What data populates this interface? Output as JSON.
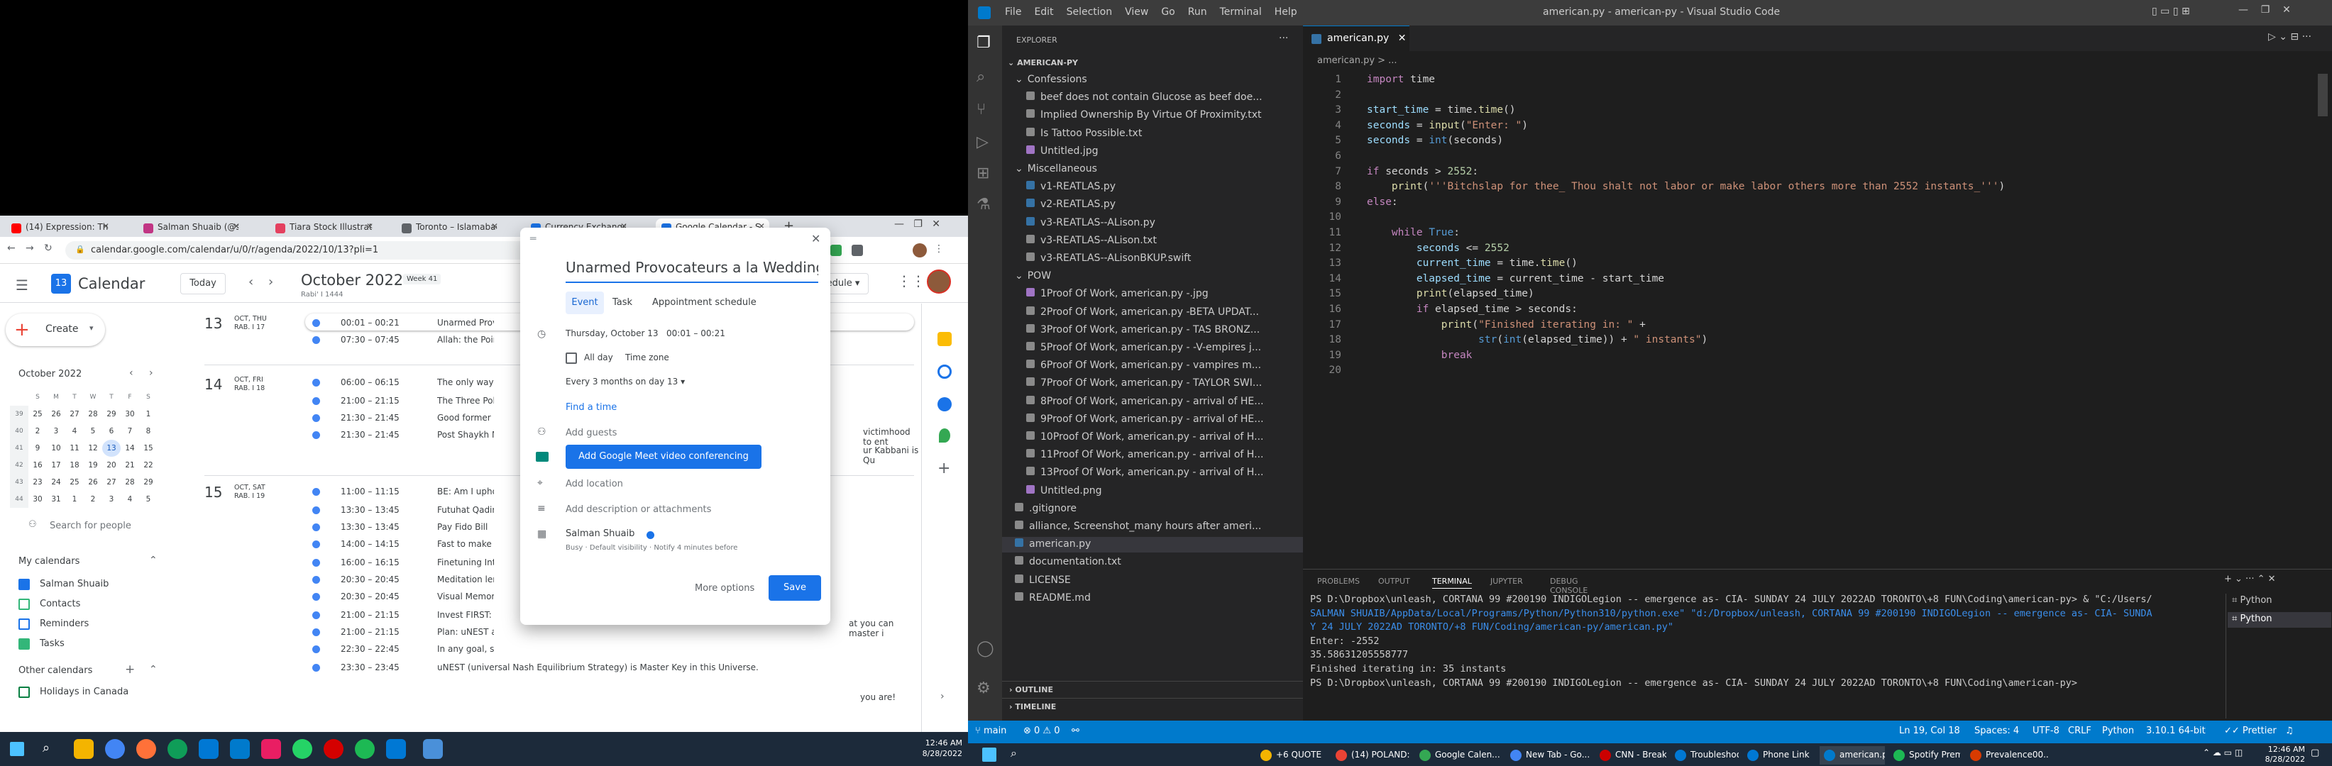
{
  "browser": {
    "tabs": [
      {
        "label": "(14) Expression: The ...",
        "color": "#ff0000"
      },
      {
        "label": "Salman Shuaib (@sa...",
        "color": "#c13584"
      },
      {
        "label": "Tiara Stock Illustratio...",
        "color": "#e4405f"
      },
      {
        "label": "Toronto – Islamabad ...",
        "color": "#5f6368"
      },
      {
        "label": "Currency Exchange R...",
        "color": "#1a73e8"
      },
      {
        "label": "Google Calendar - S...",
        "color": "#1a73e8"
      }
    ],
    "url": "calendar.google.com/calendar/u/0/r/agenda/2022/10/13?pli=1"
  },
  "calendar": {
    "app_title": "Calendar",
    "today_label": "Today",
    "month_title": "October 2022",
    "week_label": "Week 41",
    "rabi_label": "Rabi' I 1444",
    "view_label": "Schedule",
    "create_label": "Create",
    "mini_month": "October 2022",
    "mini_headers": [
      "",
      "S",
      "M",
      "T",
      "W",
      "T",
      "F",
      "S"
    ],
    "mini_rows": [
      [
        "39",
        "25",
        "26",
        "27",
        "28",
        "29",
        "30",
        "1"
      ],
      [
        "40",
        "2",
        "3",
        "4",
        "5",
        "6",
        "7",
        "8"
      ],
      [
        "41",
        "9",
        "10",
        "11",
        "12",
        "13",
        "14",
        "15"
      ],
      [
        "42",
        "16",
        "17",
        "18",
        "19",
        "20",
        "21",
        "22"
      ],
      [
        "43",
        "23",
        "24",
        "25",
        "26",
        "27",
        "28",
        "29"
      ],
      [
        "44",
        "30",
        "31",
        "1",
        "2",
        "3",
        "4",
        "5"
      ]
    ],
    "search_people": "Search for people",
    "my_calendars_title": "My calendars",
    "my_calendars": [
      {
        "label": "Salman Shuaib",
        "color": "#1a73e8",
        "checked": true
      },
      {
        "label": "Contacts",
        "color": "#33b679",
        "checked": false
      },
      {
        "label": "Reminders",
        "color": "#1a73e8",
        "checked": false
      },
      {
        "label": "Tasks",
        "color": "#33b679",
        "checked": true
      }
    ],
    "other_calendars_title": "Other calendars",
    "other_calendars": [
      {
        "label": "Holidays in Canada",
        "color": "#0b8043"
      }
    ],
    "days": [
      {
        "num": "13",
        "dow": "OCT, THU",
        "hijri": "RAB. I 17"
      },
      {
        "num": "14",
        "dow": "OCT, FRI",
        "hijri": "RAB. I 18"
      },
      {
        "num": "15",
        "dow": "OCT, SAT",
        "hijri": "RAB. I 19"
      }
    ],
    "events": [
      {
        "time": "00:01 – 00:21",
        "title": "Unarmed Provo..."
      },
      {
        "time": "07:30 – 07:45",
        "title": "Allah: the Point o..."
      },
      {
        "time": "06:00 – 06:15",
        "title": "The only way an..."
      },
      {
        "time": "21:00 – 21:15",
        "title": "The Three Polici..."
      },
      {
        "time": "21:30 – 21:45",
        "title": "Good former Bra..."
      },
      {
        "time": "21:30 – 21:45",
        "title": "Post Shaykh Me..."
      },
      {
        "time": "11:00 – 11:15",
        "title": "BE: Am I upholdi..."
      },
      {
        "time": "13:30 – 13:45",
        "title": "Futuhat Qadiriyy..."
      },
      {
        "time": "13:30 – 13:45",
        "title": "Pay Fido Bill"
      },
      {
        "time": "14:00 – 14:15",
        "title": "Fast to make sto..."
      },
      {
        "time": "16:00 – 16:15",
        "title": "Finetuning Integ..."
      },
      {
        "time": "20:30 – 20:45",
        "title": "Meditation lends..."
      },
      {
        "time": "20:30 – 20:45",
        "title": "Visual Memory N..."
      },
      {
        "time": "21:00 – 21:15",
        "title": "Invest FIRST: be..."
      },
      {
        "time": "21:00 – 21:15",
        "title": "Plan: uNEST appl..."
      },
      {
        "time": "22:30 – 22:45",
        "title": "In any goal, surro..."
      },
      {
        "time": "23:30 – 23:45",
        "title": "uNEST (universal Nash Equilibrium Strategy) is Master Key in this Universe."
      }
    ],
    "overflow_texts": [
      "victimhood to ent",
      "ur Kabbani is Qu",
      "at you can master i",
      "you are!"
    ]
  },
  "dialog": {
    "title": "Unarmed Provocateurs a la Wedding",
    "tabs": [
      "Event",
      "Task",
      "Appointment schedule"
    ],
    "date": "Thursday, October 13",
    "start": "00:01",
    "dash": "–",
    "end": "00:21",
    "all_day": "All day",
    "time_zone": "Time zone",
    "recurrence": "Every 3 months on day 13",
    "find_time": "Find a time",
    "add_guests": "Add guests",
    "meet_button": "Add Google Meet video conferencing",
    "add_location": "Add location",
    "add_description": "Add description or attachments",
    "owner": "Salman Shuaib",
    "owner_details": "Busy · Default visibility · Notify 4 minutes before",
    "more_options": "More options",
    "save": "Save"
  },
  "vscode": {
    "menu": [
      "File",
      "Edit",
      "Selection",
      "View",
      "Go",
      "Run",
      "Terminal",
      "Help"
    ],
    "window_title": "american.py - american-py - Visual Studio Code",
    "explorer_title": "EXPLORER",
    "root": "AMERICAN-PY",
    "tree": [
      {
        "label": "Confessions",
        "type": "folder"
      },
      {
        "label": "beef does not contain Glucose as beef doe...",
        "type": "file"
      },
      {
        "label": "Implied Ownership By Virtue Of Proximity.txt",
        "type": "file"
      },
      {
        "label": "Is Tattoo Possible.txt",
        "type": "file"
      },
      {
        "label": "Untitled.jpg",
        "type": "file"
      },
      {
        "label": "Miscellaneous",
        "type": "folder"
      },
      {
        "label": "v1-REATLAS.py",
        "type": "py"
      },
      {
        "label": "v2-REATLAS.py",
        "type": "py"
      },
      {
        "label": "v3-REATLAS--ALison.py",
        "type": "py"
      },
      {
        "label": "v3-REATLAS--ALison.txt",
        "type": "file"
      },
      {
        "label": "v3-REATLAS--ALisonBKUP.swift",
        "type": "file"
      },
      {
        "label": "POW",
        "type": "folder"
      },
      {
        "label": "1Proof Of Work, american.py -.jpg",
        "type": "file"
      },
      {
        "label": "2Proof Of Work, american.py -BETA UPDAT...",
        "type": "file"
      },
      {
        "label": "3Proof Of Work, american.py - TAS BRONZ...",
        "type": "file"
      },
      {
        "label": "5Proof Of Work, american.py - -V-empires j...",
        "type": "file"
      },
      {
        "label": "6Proof Of Work, american.py - vampires m...",
        "type": "file"
      },
      {
        "label": "7Proof Of Work, american.py - TAYLOR SWI...",
        "type": "file"
      },
      {
        "label": "8Proof Of Work, american.py - arrival of HE...",
        "type": "file"
      },
      {
        "label": "9Proof Of Work, american.py - arrival of HE...",
        "type": "file"
      },
      {
        "label": "10Proof Of Work, american.py - arrival of H...",
        "type": "file"
      },
      {
        "label": "11Proof Of Work, american.py - arrival of H...",
        "type": "file"
      },
      {
        "label": "13Proof Of Work, american.py - arrival of H...",
        "type": "file"
      },
      {
        "label": "Untitled.png",
        "type": "file"
      },
      {
        "label": ".gitignore",
        "type": "root"
      },
      {
        "label": "alliance, Screenshot_many hours after ameri...",
        "type": "root"
      },
      {
        "label": "american.py",
        "type": "root"
      },
      {
        "label": "documentation.txt",
        "type": "root"
      },
      {
        "label": "LICENSE",
        "type": "root"
      },
      {
        "label": "README.md",
        "type": "root"
      }
    ],
    "outline": "OUTLINE",
    "timeline": "TIMELINE",
    "editor_tab": "american.py",
    "breadcrumb": "american.py > ...",
    "panel_tabs": [
      "PROBLEMS",
      "OUTPUT",
      "TERMINAL",
      "JUPYTER",
      "DEBUG CONSOLE"
    ],
    "terminal_lines": [
      "PS D:\\Dropbox\\unleash, CORTANA 99 #200190 INDIGOLegion -- emergence as- CIA- SUNDAY 24 JULY 2022AD TORONTO\\+8 FUN\\Coding\\american-py> & \"C:/Users/",
      "SALMAN SHUAIB/AppData/Local/Programs/Python/Python310/python.exe\" \"d:/Dropbox/unleash, CORTANA 99 #200190 INDIGOLegion -- emergence as- CIA- SUNDA",
      "Y 24 JULY 2022AD TORONTO/+8 FUN/Coding/american-py/american.py\"",
      "Enter: -2552",
      "35.58631205558777",
      "Finished iterating in: 35 instants",
      "PS D:\\Dropbox\\unleash, CORTANA 99 #200190 INDIGOLegion -- emergence as- CIA- SUNDAY 24 JULY 2022AD TORONTO\\+8 FUN\\Coding\\american-py> "
    ],
    "terminal_sessions": [
      "Python",
      "Python"
    ],
    "status_left": [
      "main",
      "⊗ 0 ⚠ 0"
    ],
    "status_right": [
      "Ln 19, Col 18",
      "Spaces: 4",
      "UTF-8",
      "CRLF",
      "Python",
      "3.10.1 64-bit",
      "Prettier"
    ]
  },
  "taskbar_left": {
    "time": "12:46 AM",
    "date": "8/28/2022"
  },
  "taskbar_right": {
    "items": [
      {
        "label": "+6 QUOTE",
        "color": "#f4b400"
      },
      {
        "label": "(14) POLAND: ...",
        "color": "#ea4335"
      },
      {
        "label": "Google Calen...",
        "color": "#34a853"
      },
      {
        "label": "New Tab - Go...",
        "color": "#4285f4"
      },
      {
        "label": "CNN - Breakin...",
        "color": "#cc0000"
      },
      {
        "label": "Troubleshooti...",
        "color": "#0078d4"
      },
      {
        "label": "Phone Link",
        "color": "#0078d4"
      },
      {
        "label": "american.py -...",
        "color": "#007acc"
      },
      {
        "label": "Spotify Premi...",
        "color": "#1db954"
      },
      {
        "label": "Prevalence00...",
        "color": "#d83b01"
      }
    ],
    "time": "12:46 AM",
    "date": "8/28/2022"
  }
}
